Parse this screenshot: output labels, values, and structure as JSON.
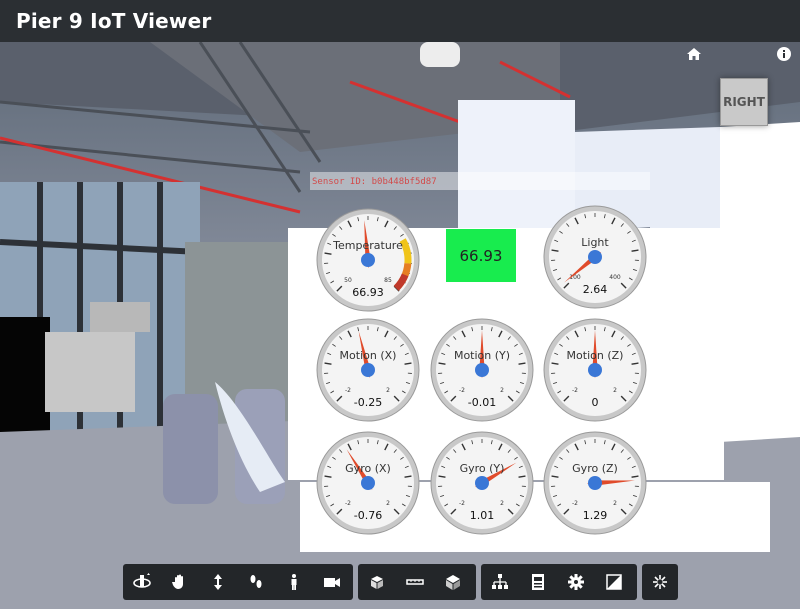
{
  "app": {
    "title": "Pier 9 IoT Viewer"
  },
  "viewcube": {
    "face": "RIGHT"
  },
  "sensor": {
    "id_label": "Sensor ID: b0b448bf5d87"
  },
  "display_value": "66.93",
  "colors": {
    "accent_green": "#18ec4e",
    "needle": "#e04b2b",
    "hub": "#3a77d6",
    "sensor_text": "#d24b4b"
  },
  "gauges": [
    {
      "label": "Temperature",
      "value": "66.93",
      "min_tick": "50",
      "max_tick": "85",
      "level": 0.48
    },
    {
      "label": "Light",
      "value": "2.64",
      "min_tick": "100",
      "max_tick": "400",
      "level": 0.02
    },
    {
      "label": "Motion (X)",
      "value": "-0.25",
      "min_tick": "-2",
      "max_tick": "2",
      "level": 0.45
    },
    {
      "label": "Motion (Y)",
      "value": "-0.01",
      "min_tick": "-2",
      "max_tick": "2",
      "level": 0.5
    },
    {
      "label": "Motion (Z)",
      "value": "0",
      "min_tick": "-2",
      "max_tick": "2",
      "level": 0.5
    },
    {
      "label": "Gyro (X)",
      "value": "-0.76",
      "min_tick": "-2",
      "max_tick": "2",
      "level": 0.38
    },
    {
      "label": "Gyro (Y)",
      "value": "1.01",
      "min_tick": "-2",
      "max_tick": "2",
      "level": 0.72
    },
    {
      "label": "Gyro (Z)",
      "value": "1.29",
      "min_tick": "-2",
      "max_tick": "2",
      "level": 0.82
    }
  ],
  "toolbar": {
    "navigation": [
      "orbit-icon",
      "pan-icon",
      "dolly-icon",
      "walk-icon",
      "first-person-icon",
      "camera-icon"
    ],
    "modeling": [
      "explode-icon",
      "measure-icon",
      "section-icon"
    ],
    "settings": [
      "model-browser-icon",
      "properties-icon",
      "gear-icon",
      "fullscreen-icon"
    ],
    "extra": [
      "sparkle-icon"
    ]
  }
}
